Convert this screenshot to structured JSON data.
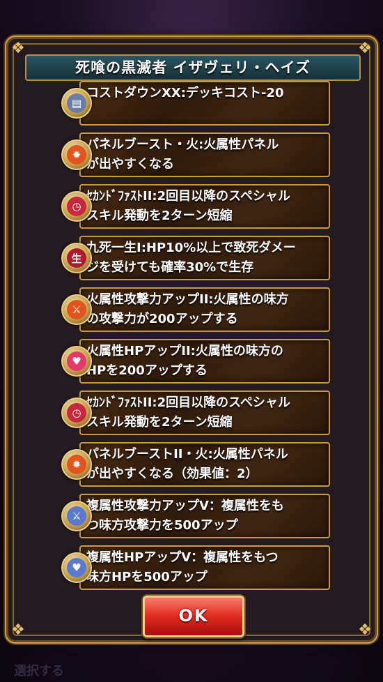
{
  "dialog": {
    "title": "死喰の黒滅者 イザヴェリ・ヘイズ",
    "ok_label": "OK"
  },
  "skills": [
    {
      "text": "コストダウンXX:デッキコスト-20",
      "icon": "card-icon",
      "icon_color": "#6a7ea8",
      "glyph": "▤"
    },
    {
      "text": "パネルブースト・火:火属性パネル\nが出やすくなる",
      "icon": "fire-panel-icon",
      "icon_color": "#e2541c",
      "glyph": "✹"
    },
    {
      "text": "ｾｶﾝﾄﾞﾌｧｽﾄII:2回目以降のスペシャル\nスキル発動を2ターン短縮",
      "icon": "sp-clock-icon",
      "icon_color": "#c8283c",
      "glyph": "◷"
    },
    {
      "text": "九死一生I:HP10%以上で致死ダメー\nジを受けても確率30%で生存",
      "icon": "kanji-icon",
      "icon_color": "#b01830",
      "glyph": "生"
    },
    {
      "text": "火属性攻撃力アップII:火属性の味方\nの攻撃力が200アップする",
      "icon": "fire-attack-icon",
      "icon_color": "#e2541c",
      "glyph": "⚔"
    },
    {
      "text": "火属性HPアップII:火属性の味方の\nHPを200アップする",
      "icon": "fire-hp-icon",
      "icon_color": "#e23a6a",
      "glyph": "♥"
    },
    {
      "text": "ｾｶﾝﾄﾞﾌｧｽﾄII:2回目以降のスペシャル\nスキル発動を2ターン短縮",
      "icon": "sp-clock-icon",
      "icon_color": "#c8283c",
      "glyph": "◷"
    },
    {
      "text": "パネルブーストII・火:火属性パネル\nが出やすくなる（効果値：2）",
      "icon": "fire-panel-icon",
      "icon_color": "#e2541c",
      "glyph": "✹"
    },
    {
      "text": "複属性攻撃力アップV：複属性をも\nつ味方攻撃力を500アップ",
      "icon": "multi-attack-icon",
      "icon_color": "#5a7ad0",
      "glyph": "⚔"
    },
    {
      "text": "複属性HPアップV：複属性をもつ\n味方HPを500アップ",
      "icon": "multi-hp-icon",
      "icon_color": "#5a7ad0",
      "glyph": "♥"
    }
  ],
  "background": {
    "bottom_text": "選択する"
  }
}
